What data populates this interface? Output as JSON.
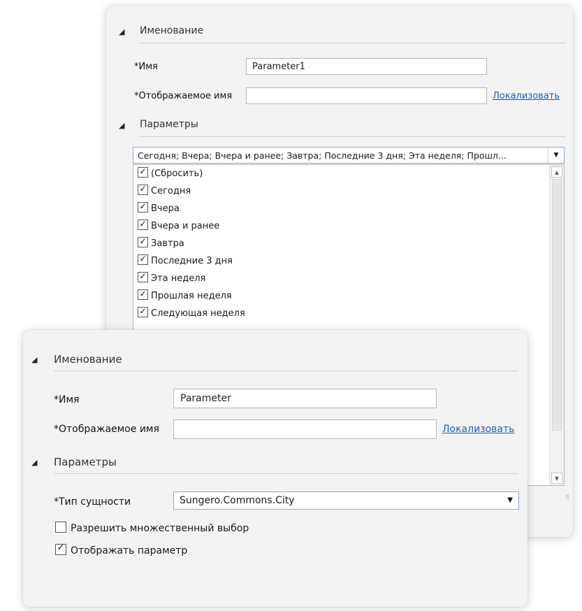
{
  "back_panel": {
    "naming": {
      "title": "Именование",
      "name_label": "*Имя",
      "name_value": "Parameter1",
      "display_label": "*Отображаемое имя",
      "display_value": "",
      "localize_link": "Локализовать"
    },
    "params": {
      "title": "Параметры",
      "combo_value": "Сегодня; Вчера; Вчера и ранее; Завтра; Последние 3 дня; Эта неделя; Прошл...",
      "options": [
        {
          "label": "(Сбросить)",
          "checked": true
        },
        {
          "label": "Сегодня",
          "checked": true
        },
        {
          "label": "Вчера",
          "checked": true
        },
        {
          "label": "Вчера и ранее",
          "checked": true
        },
        {
          "label": "Завтра",
          "checked": true
        },
        {
          "label": "Последние 3 дня",
          "checked": true
        },
        {
          "label": "Эта неделя",
          "checked": true
        },
        {
          "label": "Прошлая неделя",
          "checked": true
        },
        {
          "label": "Следующая неделя",
          "checked": true
        }
      ]
    }
  },
  "front_panel": {
    "naming": {
      "title": "Именование",
      "name_label": "*Имя",
      "name_value": "Parameter",
      "display_label": "*Отображаемое имя",
      "display_value": "",
      "localize_link": "Локализовать"
    },
    "params": {
      "title": "Параметры",
      "entity_label": "*Тип сущности",
      "entity_value": "Sungero.Commons.City",
      "multi_select_label": "Разрешить множественный выбор",
      "multi_select_checked": false,
      "show_param_label": "Отображать параметр",
      "show_param_checked": true
    }
  },
  "icons": {
    "section_toggle": "collapse-triangle-icon",
    "dropdown": "chevron-down-icon"
  },
  "colors": {
    "panel_bg": "#f3f3f3",
    "link": "#1a5fb4",
    "focus_border": "#8aa8d8"
  }
}
